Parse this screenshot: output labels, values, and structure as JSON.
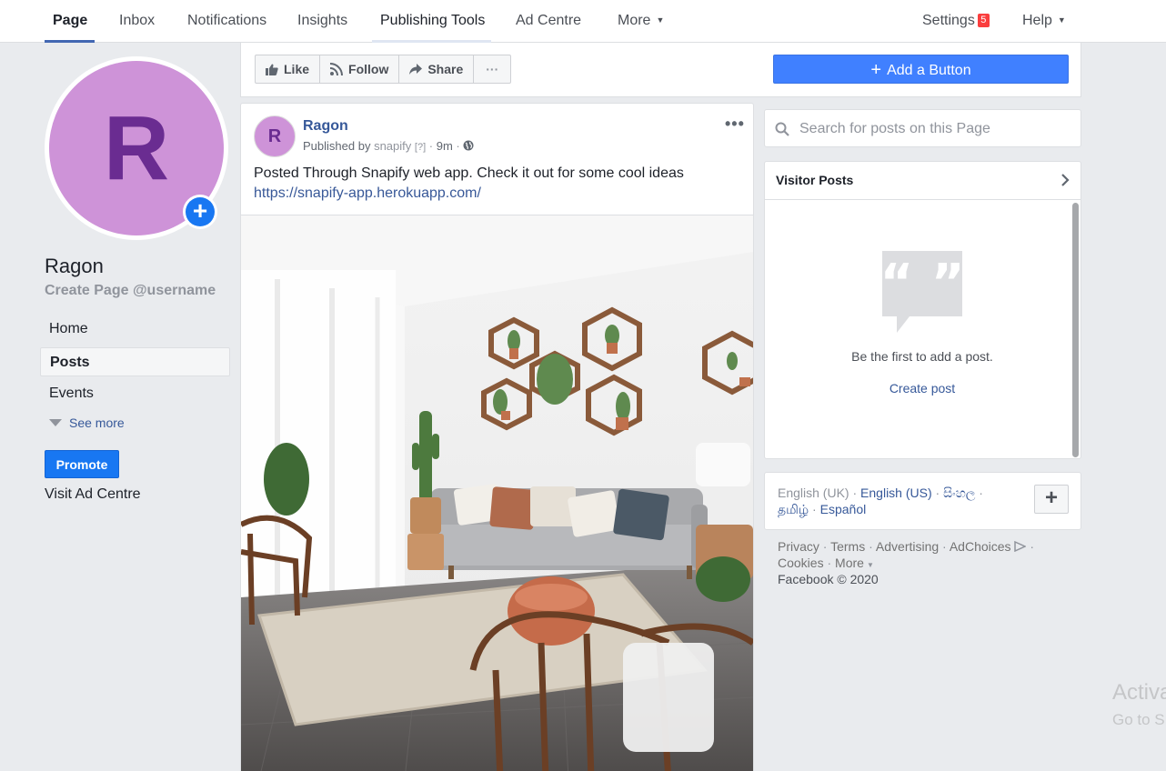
{
  "nav": {
    "tabs": [
      {
        "label": "Page"
      },
      {
        "label": "Inbox"
      },
      {
        "label": "Notifications"
      },
      {
        "label": "Insights"
      },
      {
        "label": "Publishing Tools"
      },
      {
        "label": "Ad Centre"
      },
      {
        "label": "More"
      }
    ],
    "settings_label": "Settings",
    "settings_badge": "5",
    "help_label": "Help",
    "active_tab": "Page"
  },
  "profile": {
    "avatar_letter": "R",
    "name": "Ragon",
    "username_cta": "Create Page @username",
    "avatar_color": "#ce93d8"
  },
  "leftnav": {
    "items": [
      {
        "label": "Home"
      },
      {
        "label": "Posts"
      },
      {
        "label": "Events"
      }
    ],
    "active": "Posts",
    "see_more": "See more",
    "promote": "Promote",
    "visit_ad": "Visit Ad Centre"
  },
  "actions": {
    "like": "Like",
    "follow": "Follow",
    "share": "Share",
    "more": "···",
    "add_button": "Add a Button",
    "add_button_icon": "+"
  },
  "post": {
    "avatar_letter": "R",
    "author": "Ragon",
    "published_by": "Published by",
    "publisher": "snapify",
    "publisher_hint": "[?]",
    "time": "9m",
    "text": "Posted Through Snapify web app. Check it out for some cool ideas",
    "link": "https://snapify-app.herokuapp.com/",
    "menu": "•••"
  },
  "search": {
    "placeholder": "Search for posts on this Page"
  },
  "visitor_posts": {
    "title": "Visitor Posts",
    "empty_text": "Be the first to add a post.",
    "create_link": "Create post"
  },
  "languages": {
    "current": "English (UK)",
    "options": [
      "English (US)",
      "සිංහල",
      "தமிழ்",
      "Español"
    ]
  },
  "footer": {
    "links": [
      "Privacy",
      "Terms",
      "Advertising",
      "AdChoices",
      "Cookies",
      "More"
    ],
    "copyright": "Facebook © 2020"
  },
  "watermark": {
    "line1": "Activa",
    "line2": "Go to S"
  },
  "colors": {
    "brand_blue": "#4267b2",
    "primary_button": "#1877f2",
    "add_button": "#4080ff",
    "link": "#365899",
    "badge": "#fa3e3e"
  }
}
